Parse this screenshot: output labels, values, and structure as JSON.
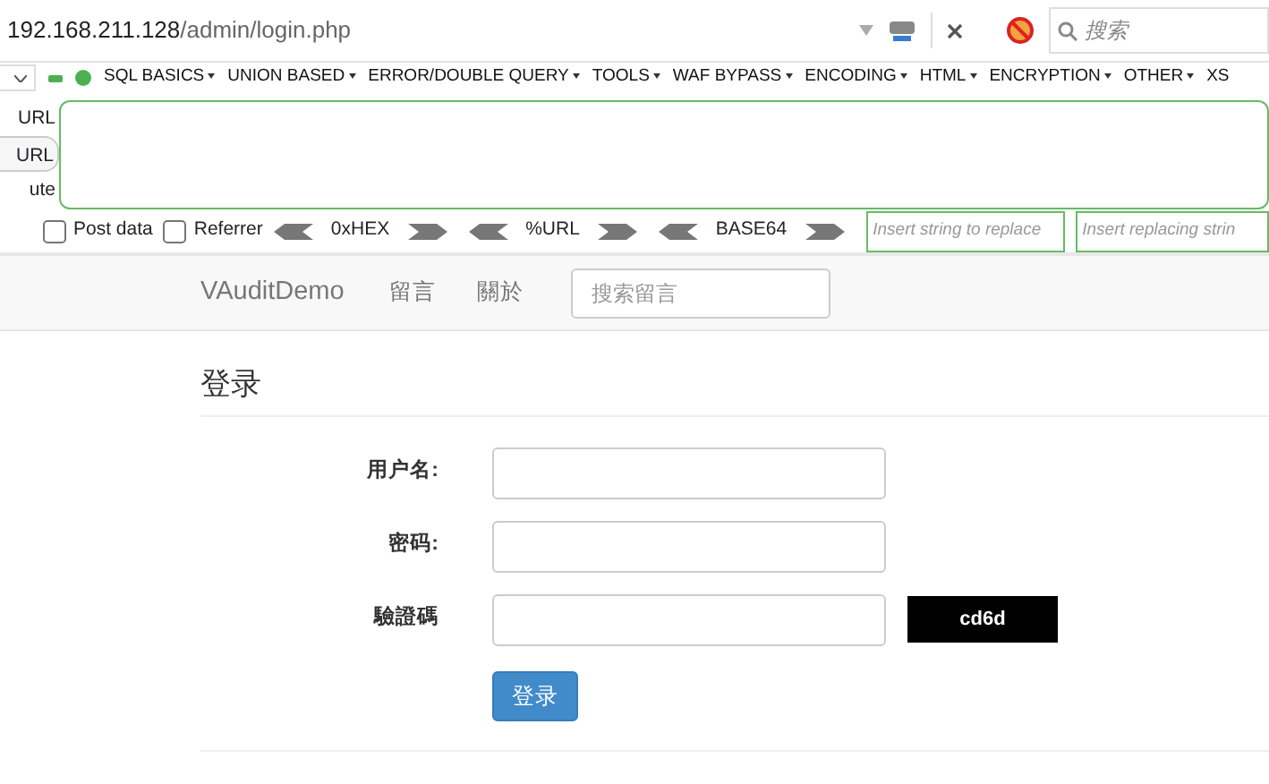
{
  "address_bar": {
    "host": "192.168.211.128",
    "path": "/admin/login.php",
    "search_placeholder": "搜索"
  },
  "hackbar": {
    "menus": [
      "SQL BASICS",
      "UNION BASED",
      "ERROR/DOUBLE QUERY",
      "TOOLS",
      "WAF BYPASS",
      "ENCODING",
      "HTML",
      "ENCRYPTION",
      "OTHER",
      "XS"
    ],
    "side_buttons": [
      {
        "label": "URL",
        "kind": "plain"
      },
      {
        "label": "URL",
        "kind": "button"
      },
      {
        "label": "ute",
        "kind": "plain"
      }
    ],
    "checkboxes": [
      {
        "label": "Post data",
        "checked": false
      },
      {
        "label": "Referrer",
        "checked": false
      }
    ],
    "encoders": [
      "0xHEX",
      "%URL",
      "BASE64"
    ],
    "replace_fields": [
      {
        "placeholder": "Insert string to replace"
      },
      {
        "placeholder": "Insert replacing strin"
      }
    ]
  },
  "site": {
    "brand": "VAuditDemo",
    "nav_links": [
      "留言",
      "關於"
    ],
    "search_placeholder": "搜索留言",
    "heading": "登录",
    "fields": [
      {
        "label": "用户名:",
        "kind": "text"
      },
      {
        "label": "密码:",
        "kind": "password"
      },
      {
        "label": "驗證碼",
        "kind": "captcha",
        "captcha": "cd6d"
      }
    ],
    "submit": "登录"
  }
}
